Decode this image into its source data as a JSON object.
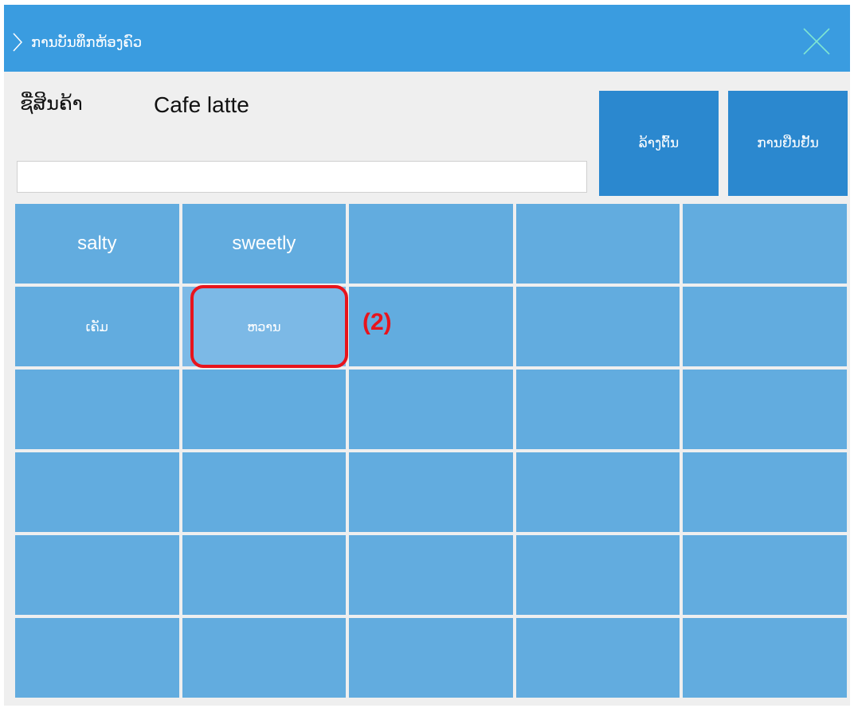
{
  "dialog": {
    "title": "ການບັນທຶກຫ້ອງຄົວ"
  },
  "product": {
    "label": "ຊື່ສິນຄ້າ",
    "name": "Cafe latte"
  },
  "note_input": {
    "value": "",
    "placeholder": ""
  },
  "buttons": {
    "clear_label": "ລ້າງຕົ້ນ",
    "confirm_label": "ການຢືນຢັ້ນ"
  },
  "grid": {
    "rows": 6,
    "cols": 5,
    "cells": [
      {
        "label": "salty",
        "lang": "en"
      },
      {
        "label": "sweetly",
        "lang": "en"
      },
      {
        "label": "",
        "lang": "en"
      },
      {
        "label": "",
        "lang": "en"
      },
      {
        "label": "",
        "lang": "en"
      },
      {
        "label": "ເຄັມ",
        "lang": "lo"
      },
      {
        "label": "ຫວານ",
        "lang": "lo",
        "selected": true
      },
      {
        "label": "",
        "lang": "en"
      },
      {
        "label": "",
        "lang": "en"
      },
      {
        "label": "",
        "lang": "en"
      }
    ]
  },
  "annotation": {
    "label": "(2)",
    "color": "#e8141c"
  },
  "colors": {
    "titlebar": "#3a9ce0",
    "action_button": "#2b88cf",
    "cell": "#62acdf",
    "cell_selected": "#7cb9e6"
  }
}
